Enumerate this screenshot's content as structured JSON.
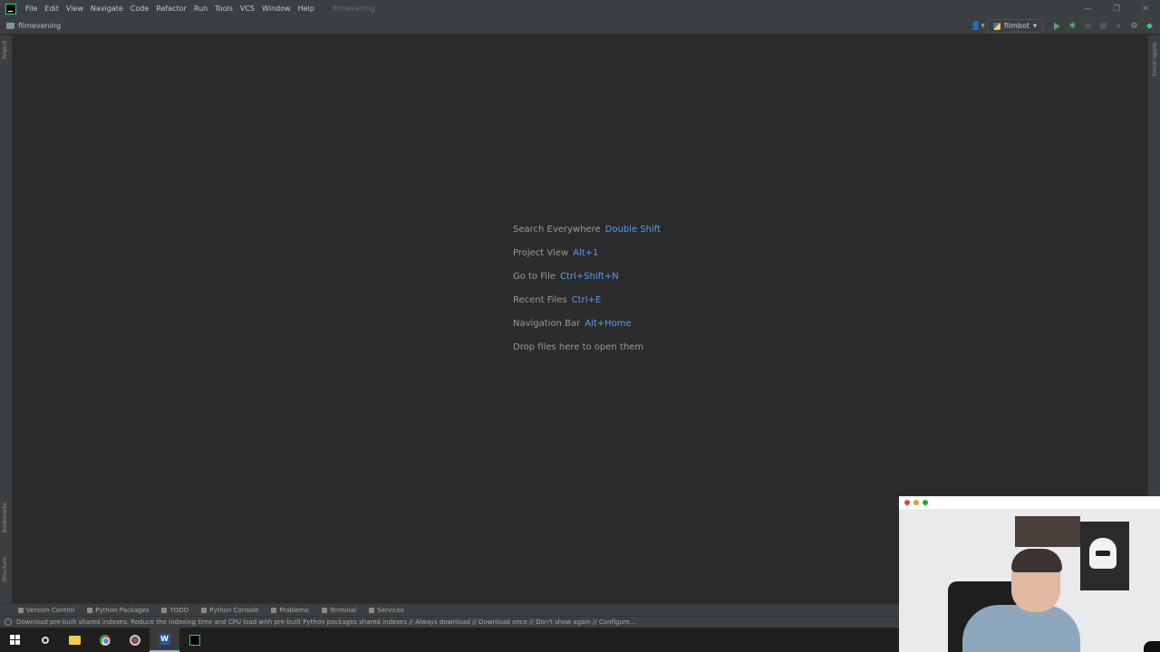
{
  "menubar": {
    "items": [
      "File",
      "Edit",
      "View",
      "Navigate",
      "Code",
      "Refactor",
      "Run",
      "Tools",
      "VCS",
      "Window",
      "Help"
    ],
    "window_title": "filmevening"
  },
  "navbar": {
    "project": "filmevening",
    "run_config": "filmbot"
  },
  "left_tabs": {
    "project": "Project",
    "bookmarks": "Bookmarks",
    "structure": "Structure"
  },
  "right_tabs": {
    "notifications": "Notifications"
  },
  "editor": {
    "hints": [
      {
        "label": "Search Everywhere",
        "key": "Double Shift"
      },
      {
        "label": "Project View",
        "key": "Alt+1"
      },
      {
        "label": "Go to File",
        "key": "Ctrl+Shift+N"
      },
      {
        "label": "Recent Files",
        "key": "Ctrl+E"
      },
      {
        "label": "Navigation Bar",
        "key": "Alt+Home"
      },
      {
        "label": "Drop files here to open them",
        "key": ""
      }
    ]
  },
  "toolwindows": {
    "version_control": "Version Control",
    "python_packages": "Python Packages",
    "todo": "TODO",
    "python_console": "Python Console",
    "problems": "Problems",
    "terminal": "Terminal",
    "services": "Services"
  },
  "status": {
    "message": "Download pre-built shared indexes: Reduce the indexing time and CPU load with pre-built Python packages shared indexes // Always download // Download once // Don't show again // Configure..."
  },
  "webcam": {
    "dot_colors": [
      "#e0443e",
      "#dea123",
      "#1aab29"
    ]
  },
  "colors": {
    "accent_shortcut": "#589df6",
    "run_green": "#59a869"
  }
}
